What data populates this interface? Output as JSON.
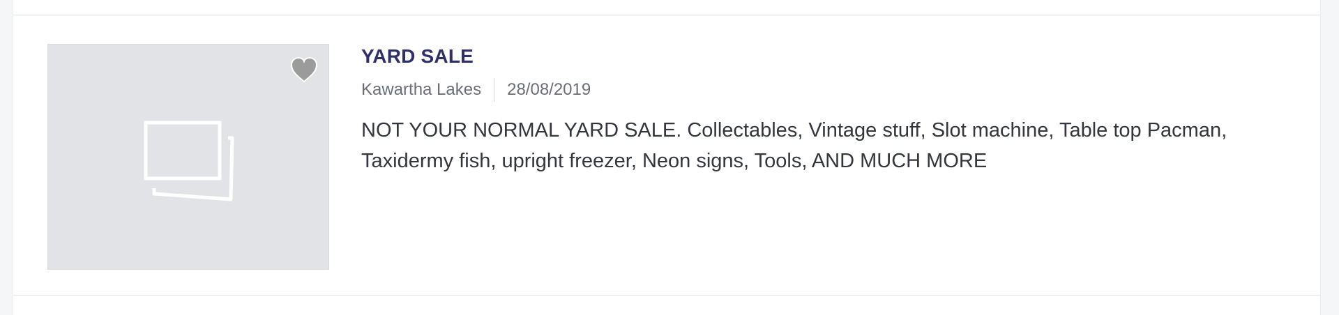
{
  "listing": {
    "title": "YARD SALE",
    "location": "Kawartha Lakes",
    "date": "28/08/2019",
    "description": "NOT YOUR NORMAL YARD SALE. Collectables, Vintage stuff, Slot machine, Table top Pacman, Taxidermy fish, upright freezer, Neon signs, Tools, AND MUCH MORE",
    "image_icon": "image-placeholder-icon",
    "favorite_icon": "heart-icon"
  },
  "colors": {
    "title": "#2f2f6b",
    "meta_text": "#6a6e78",
    "body_text": "#34363d",
    "thumbnail_bg": "#e2e3e6",
    "heart": "#9b9b9b"
  }
}
